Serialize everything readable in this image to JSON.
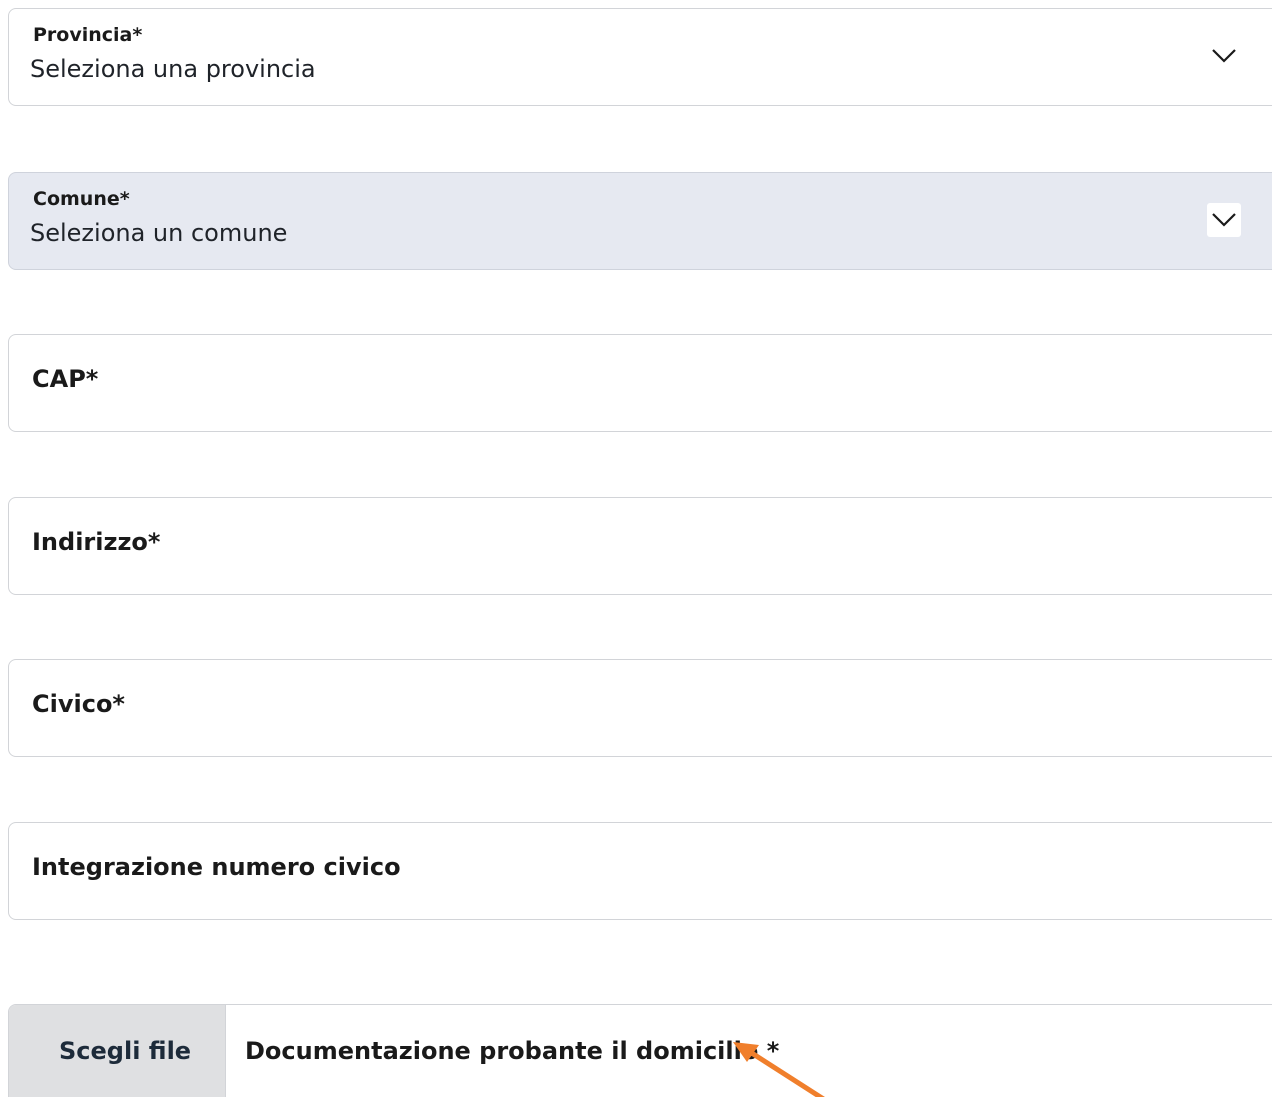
{
  "provincia": {
    "label": "Provincia*",
    "value": "Seleziona una provincia",
    "icon": "chevron-down-icon"
  },
  "comune": {
    "label": "Comune*",
    "value": "Seleziona un comune",
    "icon": "chevron-down-icon"
  },
  "cap": {
    "label": "CAP*"
  },
  "indirizzo": {
    "label": "Indirizzo*"
  },
  "civico": {
    "label": "Civico*"
  },
  "integrazione": {
    "label": "Integrazione numero civico"
  },
  "file_upload": {
    "button_label": "Scegli file",
    "label": "Documentazione probante il domicilio *"
  },
  "annotation": {
    "icon": "arrow-icon",
    "color": "#f07f2c"
  },
  "colors": {
    "disabled_background": "#e6e9f1",
    "file_button_background": "#dfe0e2",
    "border": "#d2d4d8"
  }
}
